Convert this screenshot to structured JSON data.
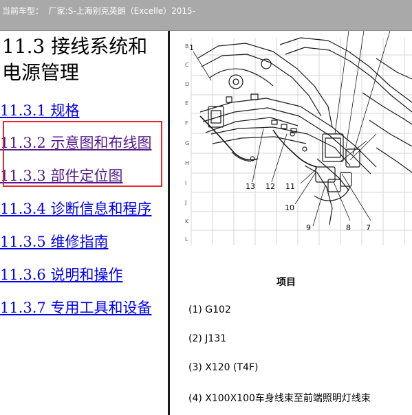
{
  "top_bar": {
    "label": "当前车型：",
    "manufacturer_label": "厂家:",
    "model": "S-上海别克英朗（Excelle）2015-"
  },
  "toc": {
    "title": "11.3 接线系统和电源管理",
    "items": [
      {
        "label": "11.3.1 规格",
        "visited": false
      },
      {
        "label": "11.3.2 示意图和布线图",
        "visited": true
      },
      {
        "label": "11.3.3 部件定位图",
        "visited": true
      },
      {
        "label": "11.3.4 诊断信息和程序",
        "visited": false
      },
      {
        "label": "11.3.5 维修指南",
        "visited": false
      },
      {
        "label": "11.3.6 说明和操作",
        "visited": false
      },
      {
        "label": "11.3.7 专用工具和设备",
        "visited": false
      }
    ],
    "highlight_color": "#e8262b",
    "link_color": "#0000ee",
    "visited_color": "#551a8b"
  },
  "diagram": {
    "row_letters": [
      "B",
      "C",
      "D",
      "E",
      "F",
      "G",
      "H",
      "I",
      "J",
      "K",
      "L"
    ],
    "callouts": [
      "1",
      "7",
      "8",
      "9",
      "10",
      "11",
      "12",
      "13"
    ]
  },
  "legend": {
    "heading": "项目",
    "items": [
      "(1) G102",
      "(2) J131",
      "(3) X120 (T4F)",
      "(4) X100X100车身线束至前端照明灯线束"
    ]
  }
}
